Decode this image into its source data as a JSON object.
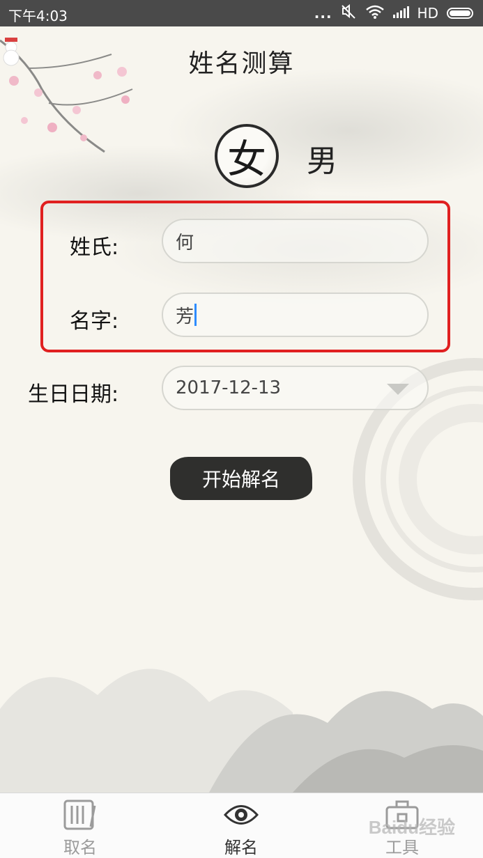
{
  "status_bar": {
    "time": "下午4:03",
    "dots": "...",
    "network": "HD"
  },
  "header": {
    "title": "姓名测算"
  },
  "gender": {
    "female": "女",
    "male": "男",
    "selected": "女"
  },
  "form": {
    "surname_label": "姓氏:",
    "surname_value": "何",
    "given_label": "名字:",
    "given_value": "芳",
    "birthday_label": "生日日期:",
    "birthday_value": "2017-12-13"
  },
  "actions": {
    "submit_label": "开始解名"
  },
  "bottom_nav": {
    "items": [
      {
        "label": "取名",
        "icon": "naming-icon",
        "active": false
      },
      {
        "label": "解名",
        "icon": "eye-icon",
        "active": true
      },
      {
        "label": "工具",
        "icon": "toolbox-icon",
        "active": false
      }
    ]
  },
  "watermark": "Baidu经验",
  "colors": {
    "highlight": "#e02020",
    "cursor": "#2d8cff",
    "button": "#2f2f2d"
  }
}
